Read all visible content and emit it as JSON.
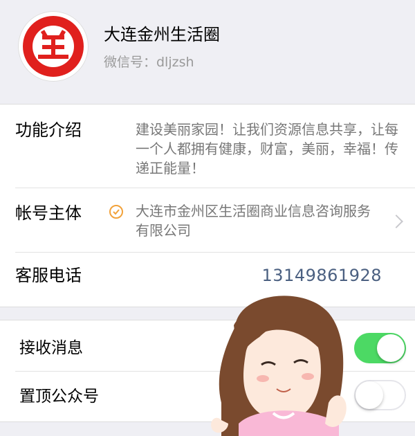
{
  "account": {
    "name": "大连金州生活圈",
    "wechat_id": "微信号：dljzsh",
    "logo_icon": "red-circle-logo-icon"
  },
  "info": {
    "intro_label": "功能介绍",
    "intro_text": "建设美丽家园！让我们资源信息共享，让每一个人都拥有健康，财富，美丽，幸福！传递正能量！",
    "entity_label": "帐号主体",
    "entity_text": "大连市金州区生活圈商业信息咨询服务有限公司",
    "phone_label": "客服电话",
    "phone_value": "13149861928"
  },
  "settings": {
    "receive_label": "接收消息",
    "receive_on": true,
    "pin_label": "置顶公众号",
    "pin_on": false
  },
  "colors": {
    "toggle_on": "#4cd964",
    "logo_red": "#e0201d",
    "verify_orange": "#f2a23a",
    "phone_blue": "#4a5f80"
  },
  "sticker": "cartoon-girl-sticker"
}
